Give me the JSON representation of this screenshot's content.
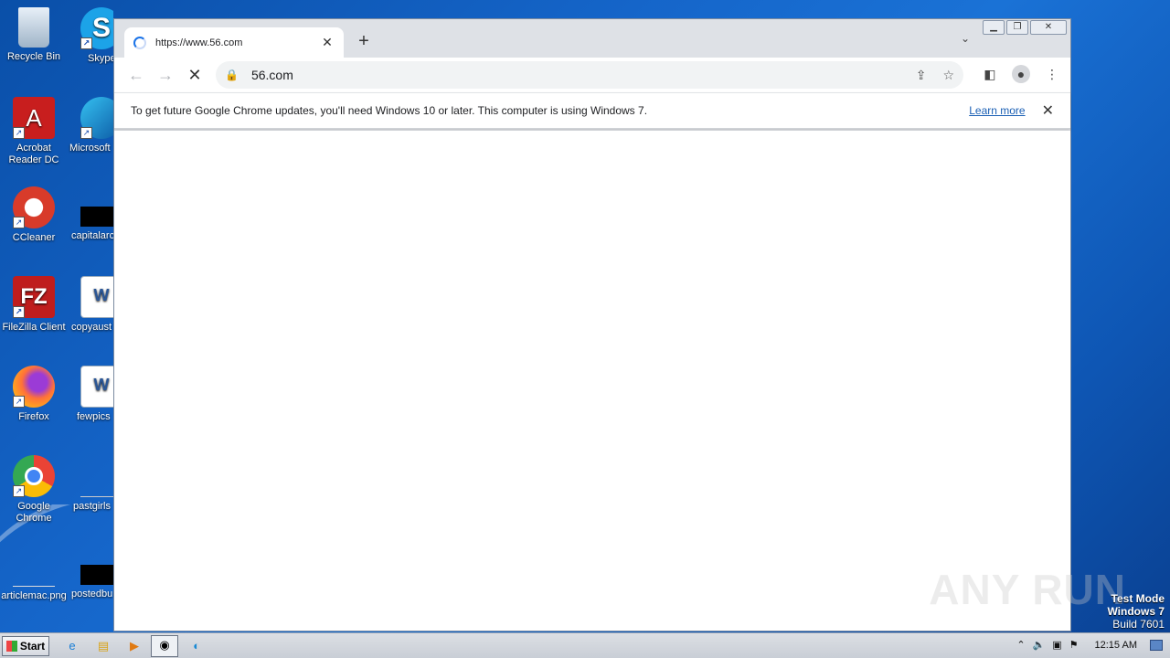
{
  "desktop": {
    "icons": [
      {
        "label": "Recycle Bin",
        "icon": "recycle-bin-icon"
      },
      {
        "label": "Skype",
        "icon": "skype-icon"
      },
      {
        "label": "Acrobat\nReader DC",
        "icon": "acrobat-icon"
      },
      {
        "label": "Microsoft",
        "icon": "edge-icon"
      },
      {
        "label": "CCleaner",
        "icon": "ccleaner-icon"
      },
      {
        "label": "capitalarc",
        "icon": "file-icon"
      },
      {
        "label": "FileZilla Client",
        "icon": "filezilla-icon"
      },
      {
        "label": "copyaust",
        "icon": "word-icon"
      },
      {
        "label": "Firefox",
        "icon": "firefox-icon"
      },
      {
        "label": "fewpics",
        "icon": "word-icon"
      },
      {
        "label": "Google\nChrome",
        "icon": "chrome-icon"
      },
      {
        "label": "pastgirls",
        "icon": "file-icon"
      },
      {
        "label": "articlemac.png",
        "icon": "image-icon"
      },
      {
        "label": "postedbu",
        "icon": "file-icon"
      }
    ]
  },
  "browser": {
    "tab_title": "https://www.56.com",
    "url": "56.com",
    "infobar_message": "To get future Google Chrome updates, you'll need Windows 10 or later. This computer is using Windows 7.",
    "infobar_link": "Learn more"
  },
  "watermark": "ANY RUN",
  "testmode": {
    "line1": "Test Mode",
    "line2": "Windows 7",
    "line3": "Build 7601"
  },
  "taskbar": {
    "start_label": "Start",
    "clock": "12:15 AM"
  }
}
